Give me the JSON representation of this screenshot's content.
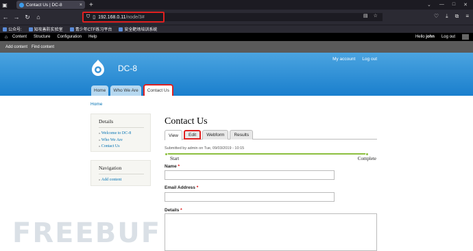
{
  "browser": {
    "tab_title": "Contact Us | DC-8",
    "url_host": "192.168.0.11",
    "url_path": "/node/3#",
    "bookmarks": [
      "公众号:",
      "知攻善防实验室",
      "青少年CTF练习平台",
      "安全靶场培训系统"
    ]
  },
  "admin_bar": {
    "menu": [
      "Content",
      "Structure",
      "Configuration",
      "Help"
    ],
    "hello": "Hello",
    "user": "john",
    "logout": "Log out",
    "shortcuts": [
      "Add content",
      "Find content"
    ]
  },
  "site": {
    "name": "DC-8",
    "secondary": [
      "My account",
      "Log out"
    ],
    "primary": [
      {
        "label": "Home"
      },
      {
        "label": "Who We Are"
      },
      {
        "label": "Contact Us"
      }
    ]
  },
  "breadcrumb": "Home",
  "sidebar": {
    "details_title": "Details",
    "details_links": [
      "Welcome to DC-8",
      "Who We Are",
      "Contact Us"
    ],
    "nav_title": "Navigation",
    "nav_links": [
      "Add content"
    ]
  },
  "page": {
    "title": "Contact Us",
    "tabs": [
      "View",
      "Edit",
      "Webform",
      "Results"
    ],
    "submitted": "Submitted by admin on Tue, 09/03/2019 - 10:15",
    "progress_start": "Start",
    "progress_end": "Complete",
    "fields": [
      {
        "label": "Name",
        "required": "*"
      },
      {
        "label": "Email Address",
        "required": "*"
      },
      {
        "label": "Details",
        "required": "*"
      }
    ]
  },
  "watermark": "FREEBUF",
  "colors": {
    "highlight": "#e02020",
    "header_top": "#4ba4e0",
    "header_bottom": "#1a7fcd",
    "link": "#0071b3"
  }
}
